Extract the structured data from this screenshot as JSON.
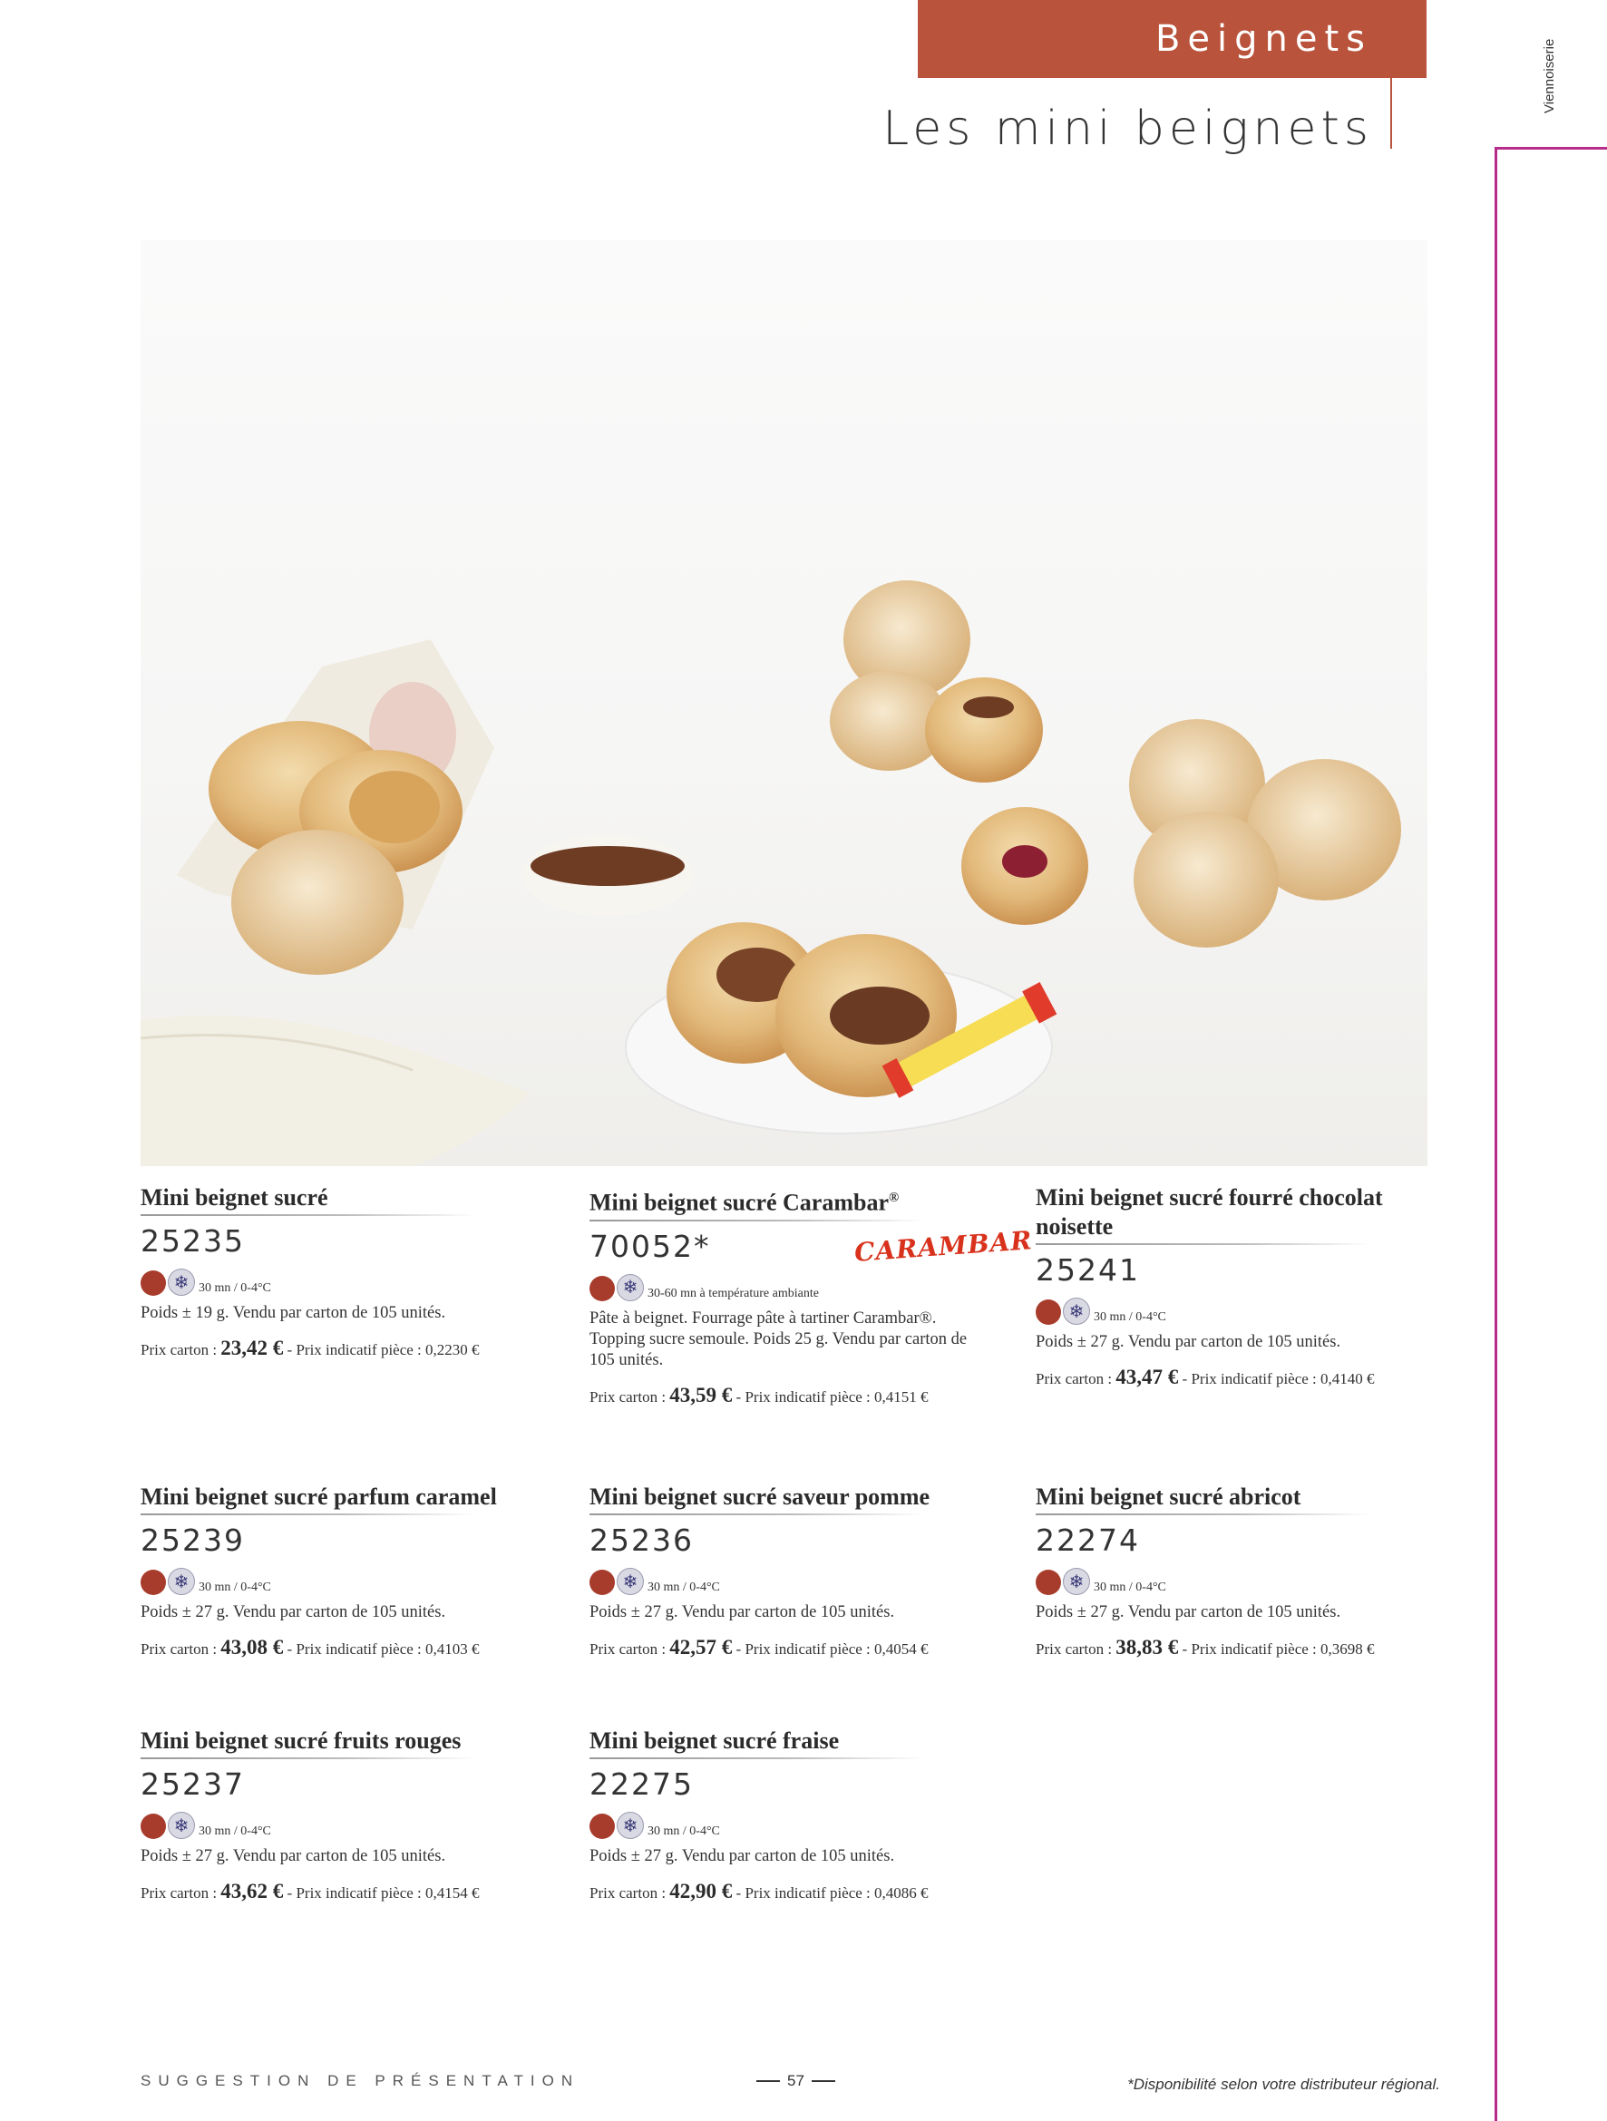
{
  "header": {
    "section": "Beignets",
    "title": "Les mini beignets",
    "side_tab": "Viennoiserie"
  },
  "products": [
    {
      "name": "Mini beignet sucré",
      "code": "25235",
      "conservation": "30 mn / 0-4°C",
      "desc": "Poids ± 19 g. Vendu par carton de 105 unités.",
      "price_label": "Prix carton : ",
      "price": "23,42 €",
      "unit_price": " - Prix indicatif pièce : 0,2230 €"
    },
    {
      "name": "Mini beignet sucré Carambar",
      "name_sup": "®",
      "code": "70052*",
      "conservation": "30-60 mn à température ambiante",
      "desc": "Pâte à beignet. Fourrage pâte à tartiner Carambar®. Topping sucre semoule. Poids 25 g. Vendu par carton de 105 unités.",
      "price_label": "Prix carton : ",
      "price": "43,59 €",
      "unit_price": " - Prix indicatif pièce : 0,4151 €"
    },
    {
      "name": "Mini beignet sucré fourré chocolat noisette",
      "code": "25241",
      "conservation": "30 mn / 0-4°C",
      "desc": "Poids ± 27 g. Vendu par carton de 105 unités.",
      "price_label": "Prix carton : ",
      "price": "43,47 €",
      "unit_price": " - Prix indicatif pièce : 0,4140 €"
    },
    {
      "name": "Mini beignet sucré parfum caramel",
      "code": "25239",
      "conservation": "30 mn / 0-4°C",
      "desc": "Poids ± 27 g. Vendu par carton de 105 unités.",
      "price_label": "Prix carton : ",
      "price": "43,08 €",
      "unit_price": " - Prix indicatif pièce : 0,4103 €"
    },
    {
      "name": "Mini beignet sucré saveur pomme",
      "code": "25236",
      "conservation": "30 mn / 0-4°C",
      "desc": "Poids ± 27 g. Vendu par carton de 105 unités.",
      "price_label": "Prix carton : ",
      "price": "42,57 €",
      "unit_price": " - Prix indicatif pièce : 0,4054 €"
    },
    {
      "name": "Mini beignet sucré abricot",
      "code": "22274",
      "conservation": "30 mn / 0-4°C",
      "desc": "Poids ± 27 g. Vendu par carton de 105 unités.",
      "price_label": "Prix carton : ",
      "price": "38,83 €",
      "unit_price": " - Prix indicatif pièce : 0,3698 €"
    },
    {
      "name": "Mini beignet sucré fruits rouges",
      "code": "25237",
      "conservation": "30 mn / 0-4°C",
      "desc": "Poids ± 27 g. Vendu par carton de 105 unités.",
      "price_label": "Prix carton : ",
      "price": "43,62 €",
      "unit_price": " - Prix indicatif pièce : 0,4154 €"
    },
    {
      "name": "Mini beignet sucré fraise",
      "code": "22275",
      "conservation": "30 mn / 0-4°C",
      "desc": "Poids ± 27 g. Vendu par carton de 105 unités.",
      "price_label": "Prix carton : ",
      "price": "42,90 €",
      "unit_price": " - Prix indicatif pièce : 0,4086 €"
    }
  ],
  "logo": "CARAMBAR",
  "footer": {
    "note": "*Disponibilité selon votre distributeur régional.",
    "suggestion": "SUGGESTION DE PRÉSENTATION",
    "page": "57"
  },
  "colors": {
    "section_bar": "#b9533b",
    "accent_line": "#b52c8a",
    "fresh_dot": "#a83c2c"
  }
}
